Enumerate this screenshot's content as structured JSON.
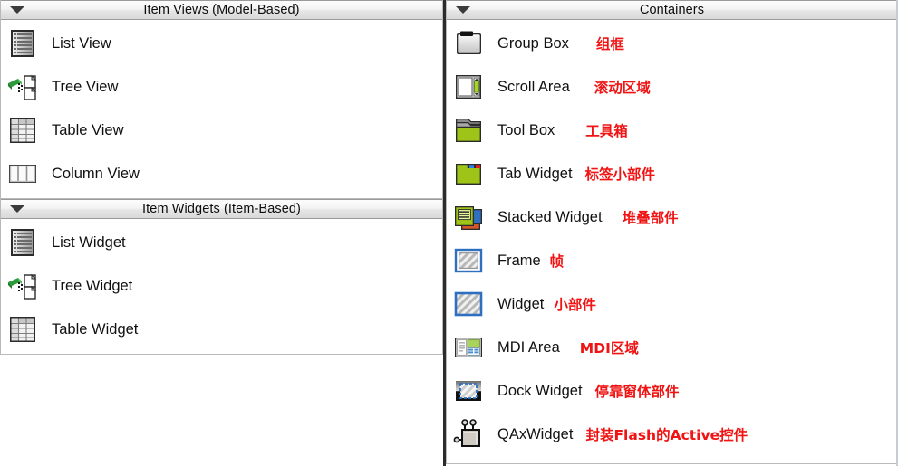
{
  "panels": {
    "left": {
      "groups": [
        {
          "title": "Item Views (Model-Based)",
          "caret": "chevron-down-icon",
          "items": [
            {
              "label": "List View",
              "icon": "list-view-icon",
              "cn": ""
            },
            {
              "label": "Tree View",
              "icon": "tree-view-icon",
              "cn": ""
            },
            {
              "label": "Table View",
              "icon": "table-view-icon",
              "cn": ""
            },
            {
              "label": "Column View",
              "icon": "column-view-icon",
              "cn": ""
            }
          ]
        },
        {
          "title": "Item Widgets (Item-Based)",
          "caret": "chevron-down-icon",
          "items": [
            {
              "label": "List Widget",
              "icon": "list-widget-icon",
              "cn": ""
            },
            {
              "label": "Tree Widget",
              "icon": "tree-widget-icon",
              "cn": ""
            },
            {
              "label": "Table Widget",
              "icon": "table-widget-icon",
              "cn": ""
            }
          ]
        }
      ]
    },
    "right": {
      "groups": [
        {
          "title": "Containers",
          "caret": "chevron-down-icon",
          "items": [
            {
              "label": "Group Box",
              "icon": "group-box-icon",
              "cn": "组框"
            },
            {
              "label": "Scroll Area",
              "icon": "scroll-area-icon",
              "cn": "滚动区域"
            },
            {
              "label": "Tool Box",
              "icon": "tool-box-icon",
              "cn": "工具箱"
            },
            {
              "label": "Tab Widget",
              "icon": "tab-widget-icon",
              "cn": "标签小部件"
            },
            {
              "label": "Stacked Widget",
              "icon": "stacked-widget-icon",
              "cn": "堆叠部件"
            },
            {
              "label": "Frame",
              "icon": "frame-icon",
              "cn": "帧"
            },
            {
              "label": "Widget",
              "icon": "widget-icon",
              "cn": "小部件"
            },
            {
              "label": "MDI Area",
              "icon": "mdi-area-icon",
              "cn": "MDI区域"
            },
            {
              "label": "Dock Widget",
              "icon": "dock-widget-icon",
              "cn": "停靠窗体部件"
            },
            {
              "label": "QAxWidget",
              "icon": "qax-widget-icon",
              "cn": "封装Flash的Active控件"
            }
          ]
        }
      ]
    }
  },
  "colors": {
    "annotation_red": "#f01414",
    "header_border": "#9a9a9a",
    "panel_divider": "#2b2b2b",
    "text": "#111111",
    "icon_green": "#8cb81e",
    "icon_blue": "#2f6fc0"
  }
}
